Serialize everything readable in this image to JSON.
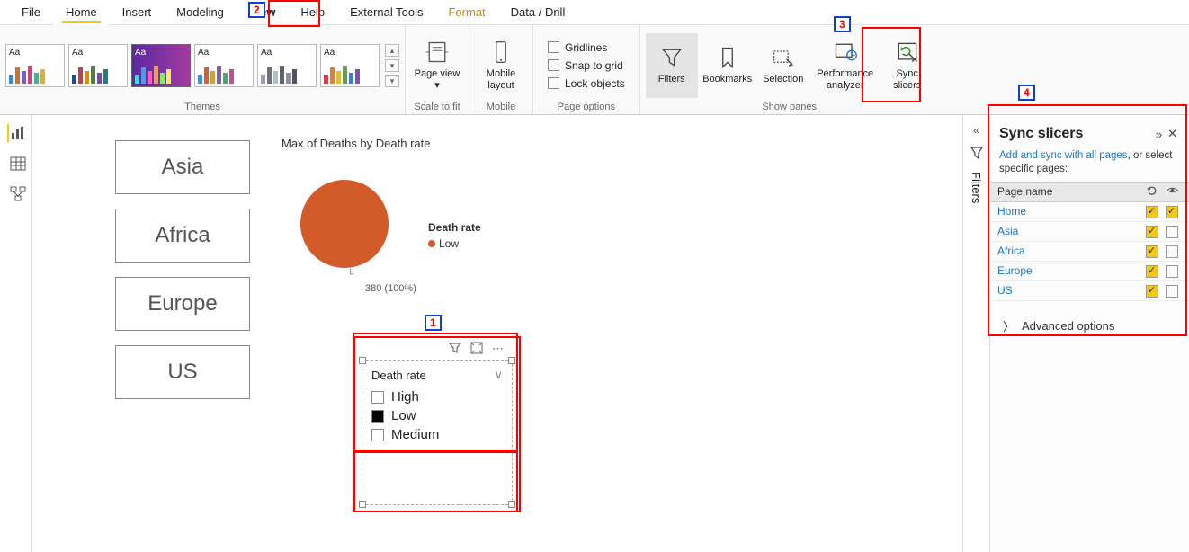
{
  "ribbon": {
    "tabs": [
      "File",
      "Home",
      "Insert",
      "Modeling",
      "View",
      "Help",
      "External Tools",
      "Format",
      "Data / Drill"
    ],
    "groups": {
      "themes": "Themes",
      "scale": "Scale to fit",
      "mobile": "Mobile",
      "page_options": "Page options",
      "show_panes": "Show panes"
    },
    "page_view": {
      "label": "Page view",
      "dropdown": "▾"
    },
    "mobile_layout": "Mobile layout",
    "options": {
      "gridlines": "Gridlines",
      "snap": "Snap to grid",
      "lock": "Lock objects"
    },
    "panes": {
      "filters": "Filters",
      "bookmarks": "Bookmarks",
      "selection": "Selection",
      "perf": "Performance analyzer",
      "sync": "Sync slicers"
    }
  },
  "canvas": {
    "regions": [
      "Asia",
      "Africa",
      "Europe",
      "US"
    ],
    "chart_title": "Max of Deaths by Death rate",
    "legend_title": "Death rate",
    "legend_item": "Low",
    "pie_label": "380 (100%)"
  },
  "chart_data": {
    "type": "pie",
    "title": "Max of Deaths by Death rate",
    "series": [
      {
        "name": "Death rate",
        "slices": [
          {
            "category": "Low",
            "value": 380,
            "pct": 100,
            "color": "#d35a29"
          }
        ]
      }
    ],
    "legend": {
      "title": "Death rate",
      "position": "right"
    }
  },
  "slicer": {
    "title": "Death rate",
    "items": [
      {
        "label": "High",
        "checked": false
      },
      {
        "label": "Low",
        "checked": true
      },
      {
        "label": "Medium",
        "checked": false
      }
    ]
  },
  "filters_rail": {
    "label": "Filters"
  },
  "sync": {
    "title": "Sync slicers",
    "desc_link": "Add and sync with all pages",
    "desc_rest": ", or select specific pages:",
    "col_header": "Page name",
    "pages": [
      {
        "name": "Home",
        "sync": true,
        "visible": true
      },
      {
        "name": "Asia",
        "sync": true,
        "visible": false
      },
      {
        "name": "Africa",
        "sync": true,
        "visible": false
      },
      {
        "name": "Europe",
        "sync": true,
        "visible": false
      },
      {
        "name": "US",
        "sync": true,
        "visible": false
      }
    ],
    "advanced": "Advanced options"
  },
  "callouts": {
    "n1": "1",
    "n2": "2",
    "n3": "3",
    "n4": "4"
  },
  "theme_aa": "Aa"
}
